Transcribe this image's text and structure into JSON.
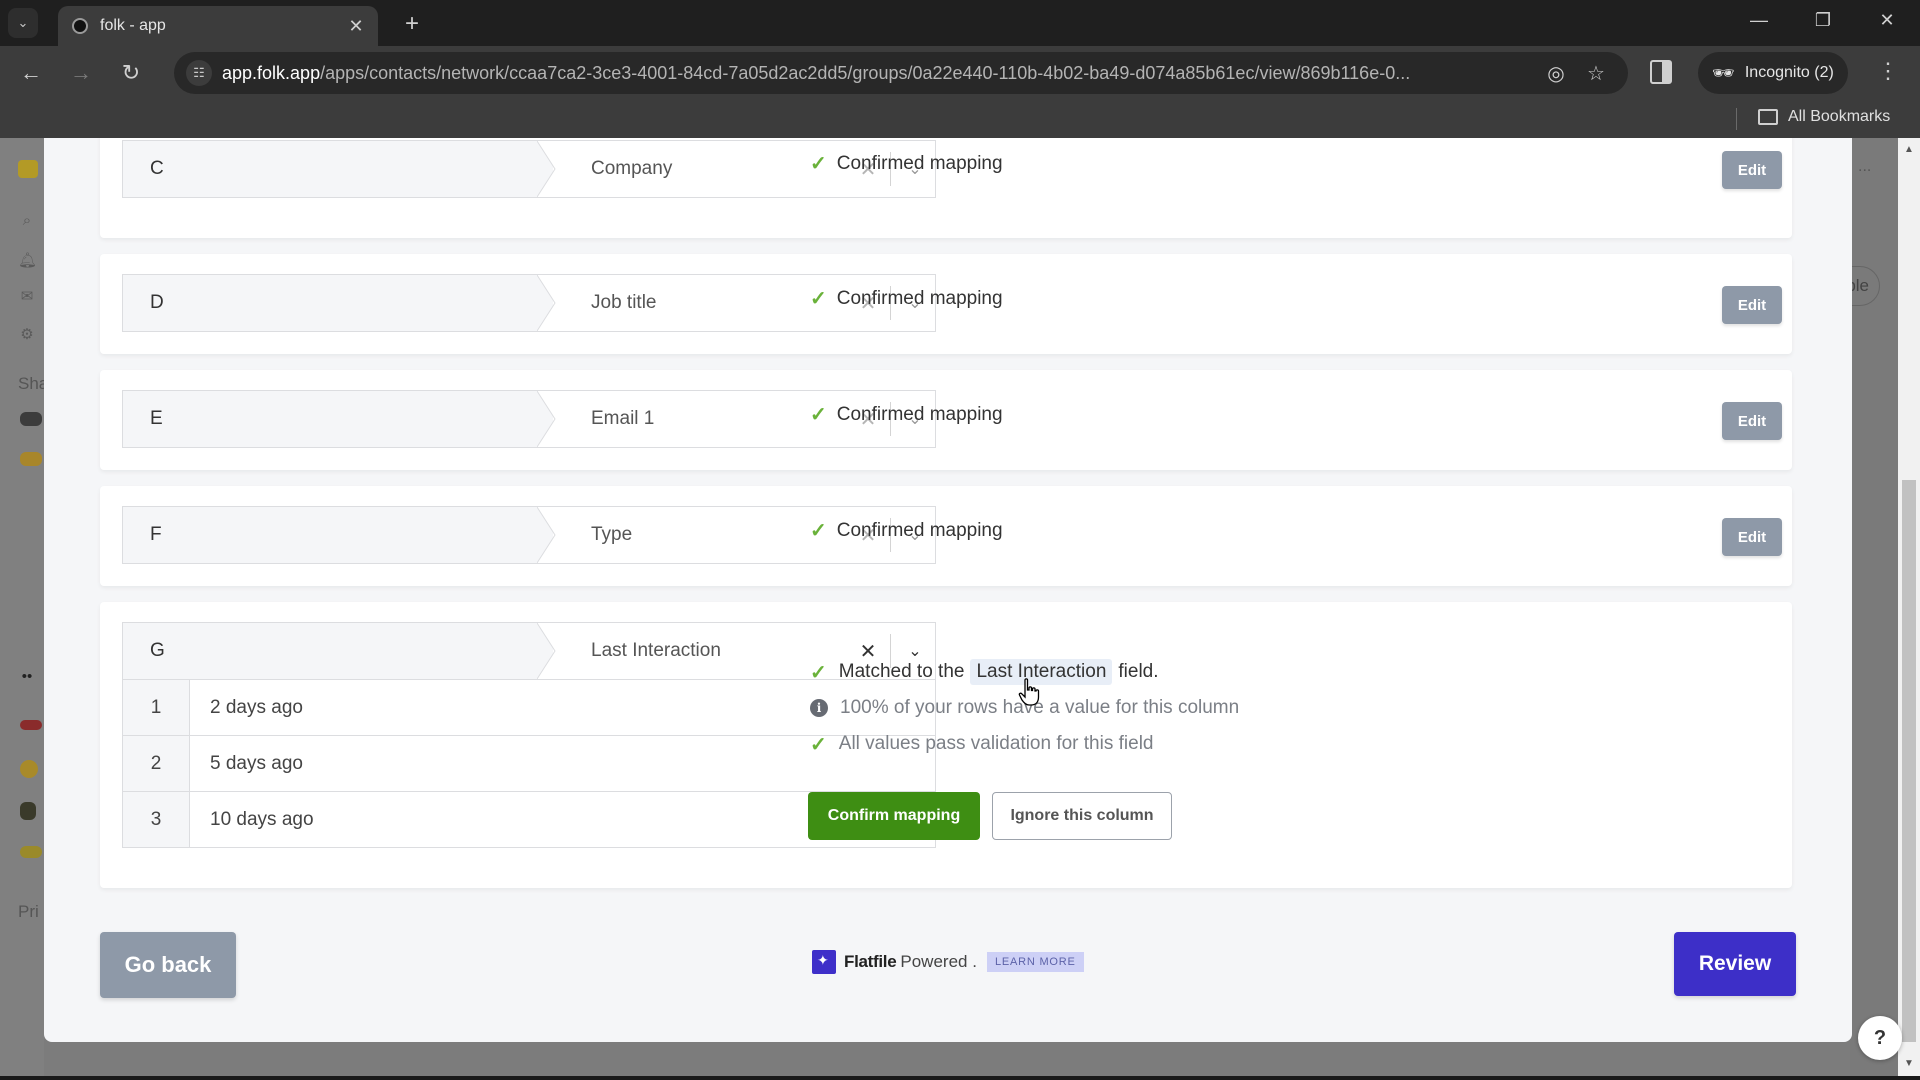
{
  "browser": {
    "tab_title": "folk - app",
    "new_tab_label": "+",
    "url_host": "app.folk.app",
    "url_path": "/apps/contacts/network/ccaa7ca2-3ce3-4001-84cd-7a05d2ac2dd5/groups/0a22e440-110b-4b02-ba49-d074a85b61ec/view/869b116e-0...",
    "incognito_label": "Incognito (2)",
    "all_bookmarks_label": "All Bookmarks"
  },
  "background_app": {
    "sidebar_section_shared": "Sha",
    "sidebar_section_private": "Pri",
    "right_pill_text": "ble",
    "right_dots": "..."
  },
  "mappings": [
    {
      "column": "C",
      "field": "Company",
      "status": "Confirmed mapping",
      "edit_label": "Edit"
    },
    {
      "column": "D",
      "field": "Job title",
      "status": "Confirmed mapping",
      "edit_label": "Edit"
    },
    {
      "column": "E",
      "field": "Email 1",
      "status": "Confirmed mapping",
      "edit_label": "Edit"
    },
    {
      "column": "F",
      "field": "Type",
      "status": "Confirmed mapping",
      "edit_label": "Edit"
    }
  ],
  "active_mapping": {
    "column": "G",
    "field": "Last Interaction",
    "sample_rows": [
      {
        "num": "1",
        "value": "2 days ago"
      },
      {
        "num": "2",
        "value": "5 days ago"
      },
      {
        "num": "3",
        "value": "10 days ago"
      }
    ],
    "matched_prefix": "Matched to the",
    "matched_field": "Last Interaction",
    "matched_suffix": "field.",
    "coverage_text": "100% of your rows have a value for this column",
    "validation_text": "All values pass validation for this field",
    "confirm_label": "Confirm mapping",
    "ignore_label": "Ignore this column"
  },
  "footer": {
    "go_back_label": "Go back",
    "brand": "Flatfile",
    "powered_text": "Powered .",
    "learn_more_label": "LEARN MORE",
    "review_label": "Review"
  },
  "help_label": "?",
  "colors": {
    "confirm_green": "#3e8e13",
    "check_green": "#6ab23a",
    "review_purple": "#3d2fc8",
    "edit_gray": "#8e99a8"
  }
}
